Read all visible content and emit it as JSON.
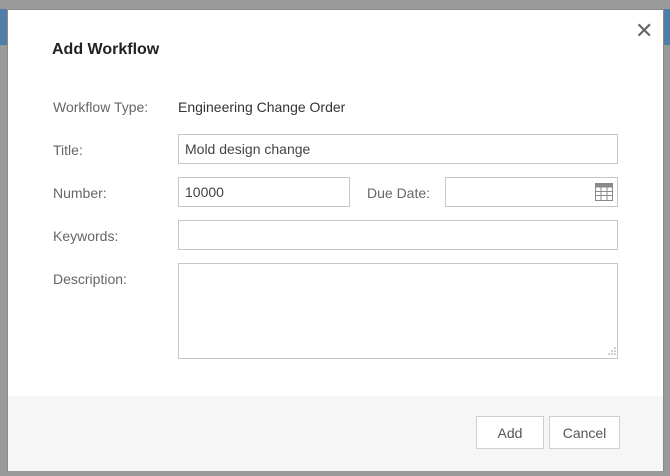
{
  "dialog": {
    "title": "Add Workflow",
    "close_icon": "close-icon"
  },
  "form": {
    "workflow_type": {
      "label": "Workflow Type:",
      "value": "Engineering Change Order"
    },
    "title": {
      "label": "Title:",
      "value": "Mold design change"
    },
    "number": {
      "label": "Number:",
      "value": "10000"
    },
    "due_date": {
      "label": "Due Date:",
      "value": "",
      "icon": "calendar-icon"
    },
    "keywords": {
      "label": "Keywords:",
      "value": ""
    },
    "description": {
      "label": "Description:",
      "value": ""
    }
  },
  "footer": {
    "add_label": "Add",
    "cancel_label": "Cancel"
  }
}
